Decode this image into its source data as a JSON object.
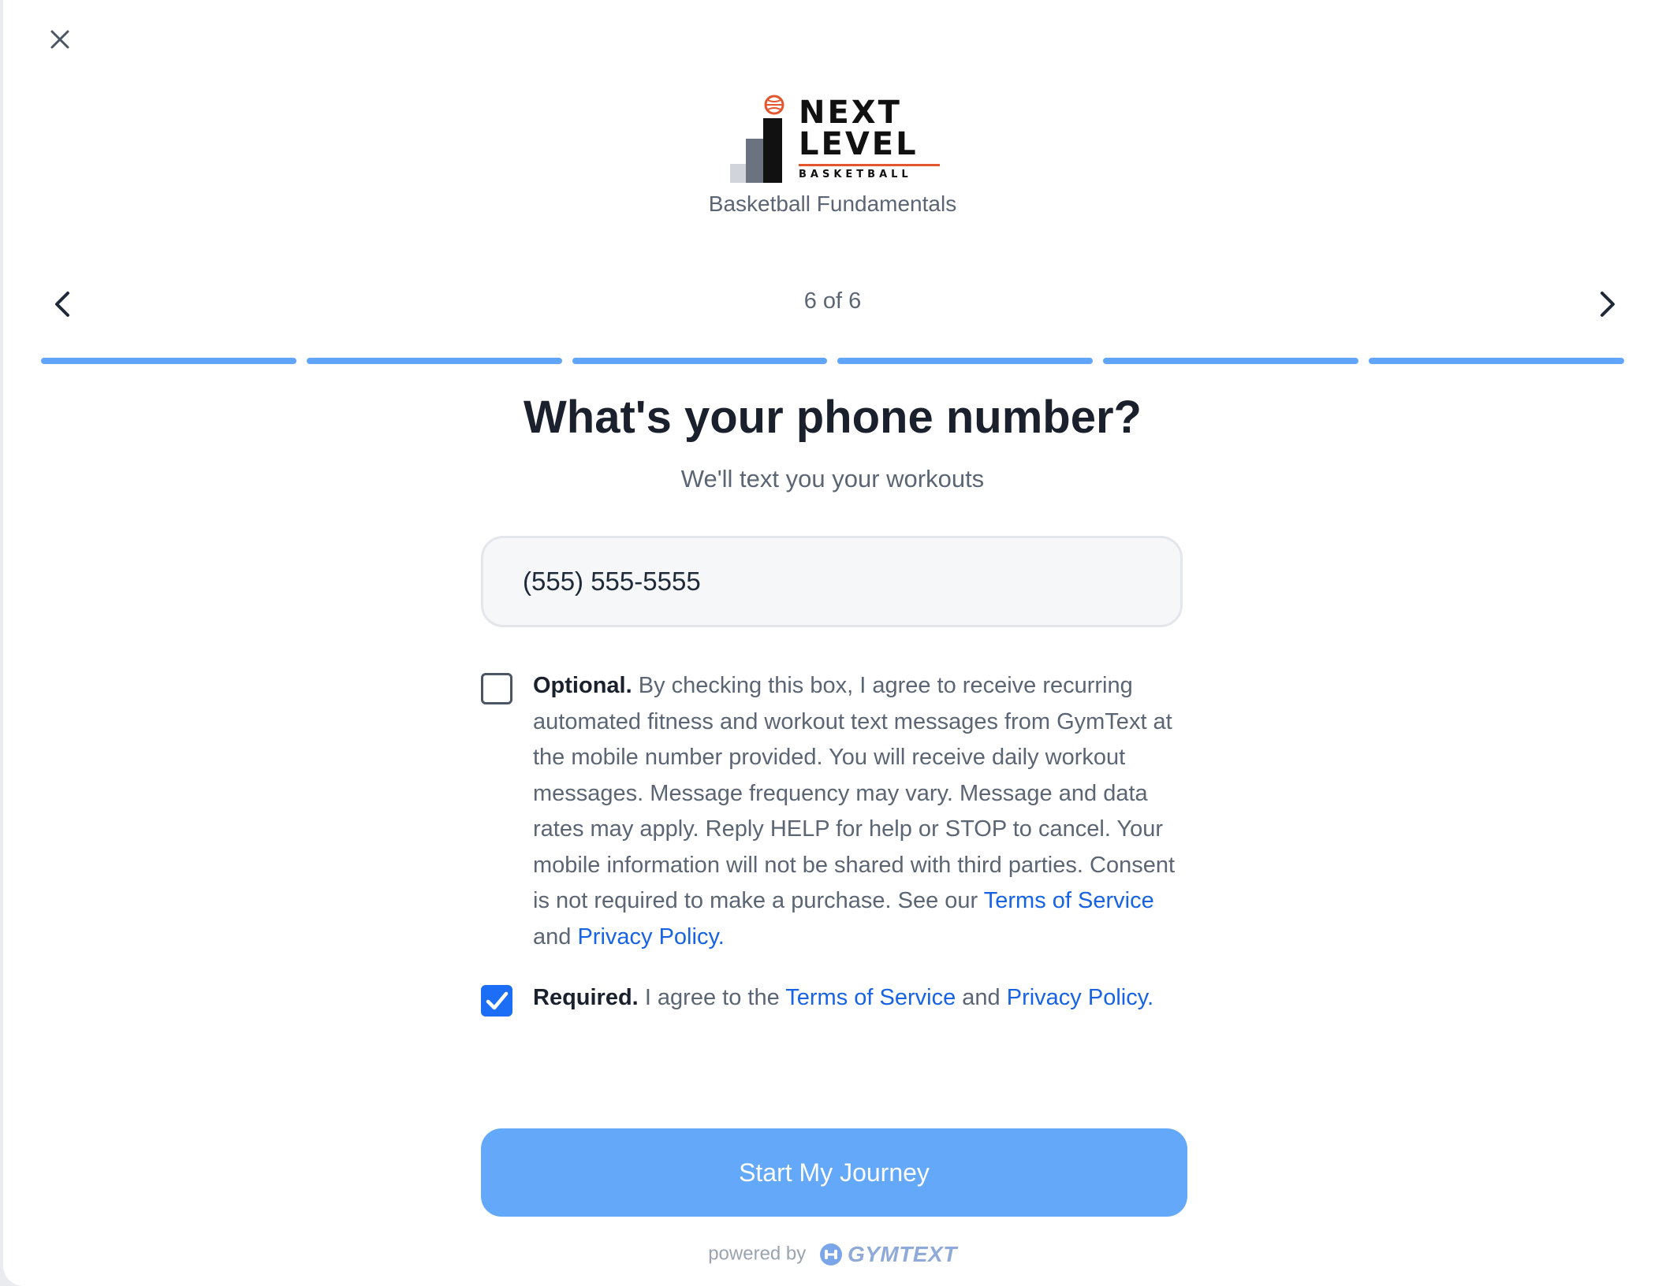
{
  "brand": {
    "logo_line1": "NEXT",
    "logo_line2": "LEVEL",
    "logo_line3": "BASKETBALL",
    "subtitle": "Basketball Fundamentals",
    "accent_color": "#e4572e"
  },
  "navigation": {
    "step_counter": "6 of 6",
    "steps_total": 6,
    "steps_completed": 6,
    "progress_color": "#60a5fa",
    "prev_icon": "chevron-left-icon",
    "next_icon": "chevron-right-icon",
    "close_icon": "close-icon"
  },
  "question": {
    "title": "What's your phone number?",
    "subtitle": "We'll text you your workouts"
  },
  "phone_input": {
    "value": "(555) 555-5555",
    "placeholder": "(555) 555-5555"
  },
  "optional_consent": {
    "checked": false,
    "label": "Optional.",
    "text": "By checking this box, I agree to receive recurring automated fitness and workout text messages from GymText at the mobile number provided. You will receive daily workout messages. Message frequency may vary. Message and data rates may apply. Reply HELP for help or STOP to cancel. Your mobile information will not be shared with third parties. Consent is not required to make a purchase. See our",
    "terms_link": "Terms of Service",
    "and": "and",
    "privacy_link": "Privacy Policy",
    "end": "."
  },
  "required_consent": {
    "checked": true,
    "label": "Required.",
    "text": "I agree to the",
    "terms_link": "Terms of Service",
    "and": "and",
    "privacy_link": "Privacy Policy",
    "end": "."
  },
  "cta": {
    "label": "Start My Journey",
    "color": "#63a8f9"
  },
  "footer": {
    "powered_by": "powered by",
    "brand_name": "GYMTEXT",
    "brand_icon": "gymtext-logo-icon"
  }
}
